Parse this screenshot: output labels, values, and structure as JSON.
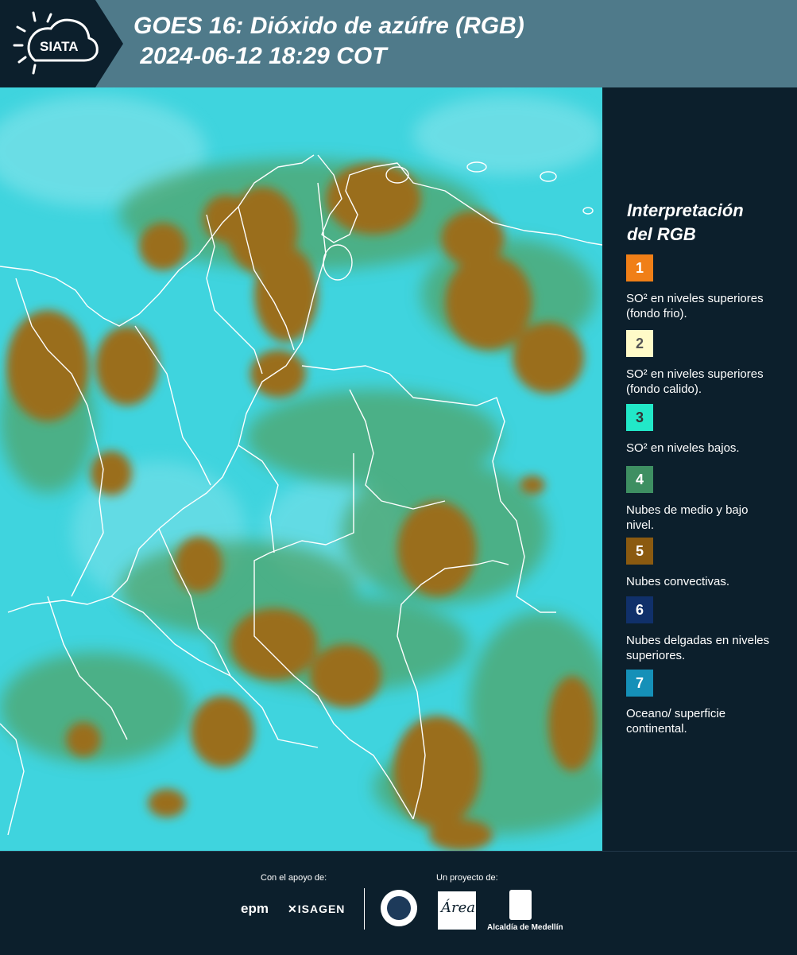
{
  "header": {
    "logo_text": "SIATA",
    "title_line1": "GOES 16: Dióxido de azúfre (RGB)",
    "title_line2": " 2024-06-12 18:29 COT"
  },
  "legend": {
    "title_line1": "Interpretación",
    "title_line2": "del RGB",
    "items": [
      {
        "num": "1",
        "color": "#f07f17",
        "num_color": "#ffffff",
        "label": "SO² en niveles superiores (fondo frio)."
      },
      {
        "num": "2",
        "color": "#fffbc8",
        "num_color": "#555555",
        "label": "SO² en niveles superiores (fondo calido)."
      },
      {
        "num": "3",
        "color": "#22e8c8",
        "num_color": "#333333",
        "label": "SO² en niveles bajos."
      },
      {
        "num": "4",
        "color": "#3e8f62",
        "num_color": "#ffffff",
        "label": "Nubes de medio y bajo nivel."
      },
      {
        "num": "5",
        "color": "#8b5a10",
        "num_color": "#ffffff",
        "label": "Nubes convectivas."
      },
      {
        "num": "6",
        "color": "#10306a",
        "num_color": "#ffffff",
        "label": "Nubes delgadas en niveles superiores."
      },
      {
        "num": "7",
        "color": "#1590b8",
        "num_color": "#ffffff",
        "label": "Oceano/ superficie continental."
      }
    ]
  },
  "footer": {
    "support_label": "Con el apoyo de:",
    "project_label": "Un proyecto de:",
    "epm_text": "epm",
    "isagen_text": "ISAGEN",
    "area_text": "Área",
    "alcaldia_text": "Alcaldía de Medellín"
  },
  "colors": {
    "background": "#0c1f2c",
    "header_band": "#4f7a8a",
    "ocean": "#3fd3de",
    "cloud": "#9a6e1e",
    "vegetation": "#5aa870"
  }
}
